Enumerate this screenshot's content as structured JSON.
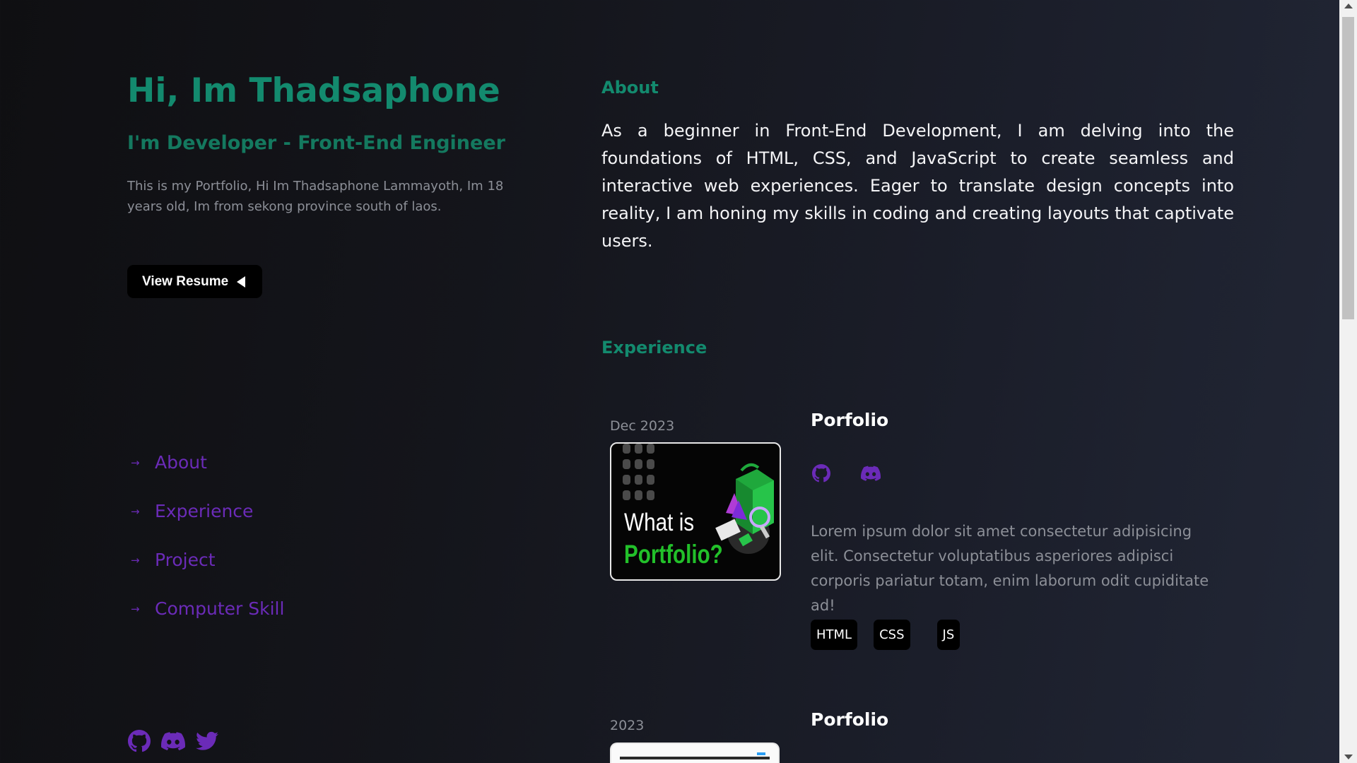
{
  "hero": {
    "title": "Hi, Im Thadsaphone",
    "subtitle": "I'm Developer - Front-End Engineer",
    "description": "This is my Portfolio, Hi Im Thadsaphone Lammayoth, Im 18 years old, Im from sekong province south of laos.",
    "resume_button": "View Resume"
  },
  "nav": {
    "items": [
      {
        "label": "About",
        "arrow": "→"
      },
      {
        "label": "Experience",
        "arrow": "→"
      },
      {
        "label": "Project",
        "arrow": "→"
      },
      {
        "label": "Computer Skill",
        "arrow": "→"
      }
    ]
  },
  "socials": [
    "github-icon",
    "discord-icon",
    "twitter-icon"
  ],
  "about": {
    "heading": "About",
    "text": "As a beginner in Front-End Development, I am delving into the foundations of HTML, CSS, and JavaScript to create seamless and interactive web experiences. Eager to translate design concepts into reality, I am honing my skills in coding and creating layouts that captivate users."
  },
  "experience": {
    "heading": "Experience",
    "items": [
      {
        "date": "Dec 2023",
        "thumbnail_text_1": "What is",
        "thumbnail_text_2": "Portfolio?",
        "title": "Porfolio",
        "description": "Lorem ipsum dolor sit amet consectetur adipisicing elit. Consectetur voluptatibus asperiores adipisci corporis pariatur totam, enim laborum odit cupiditate ad!",
        "tags": [
          "HTML",
          "CSS",
          "JS"
        ]
      },
      {
        "date": "2023",
        "title": "Porfolio"
      }
    ]
  },
  "colors": {
    "accent_green": "#138a6e",
    "accent_purple": "#6b2bb8",
    "muted_text": "#8c8f97",
    "thumbnail_green": "#22c02a"
  }
}
